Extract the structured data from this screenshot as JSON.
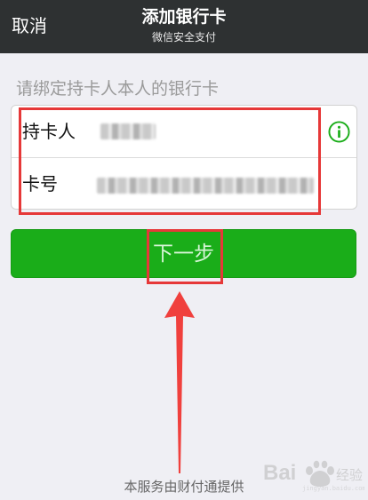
{
  "nav": {
    "cancel_label": "取消",
    "title": "添加银行卡",
    "subtitle": "微信安全支付"
  },
  "form": {
    "hint": "请绑定持卡人本人的银行卡",
    "cardholder": {
      "label": "持卡人",
      "value_masked": "pixelated"
    },
    "card_number": {
      "label": "卡号",
      "value_masked": "pixelated"
    },
    "info_icon": "info-icon"
  },
  "next_button": {
    "label": "下一步"
  },
  "footer": {
    "text": "本服务由财付通提供"
  },
  "watermark": {
    "text": "Bai 经验"
  },
  "colors": {
    "nav_bg": "#2e3132",
    "page_bg": "#efeff4",
    "button_green": "#1aad19",
    "annotation_red": "#e63838"
  }
}
